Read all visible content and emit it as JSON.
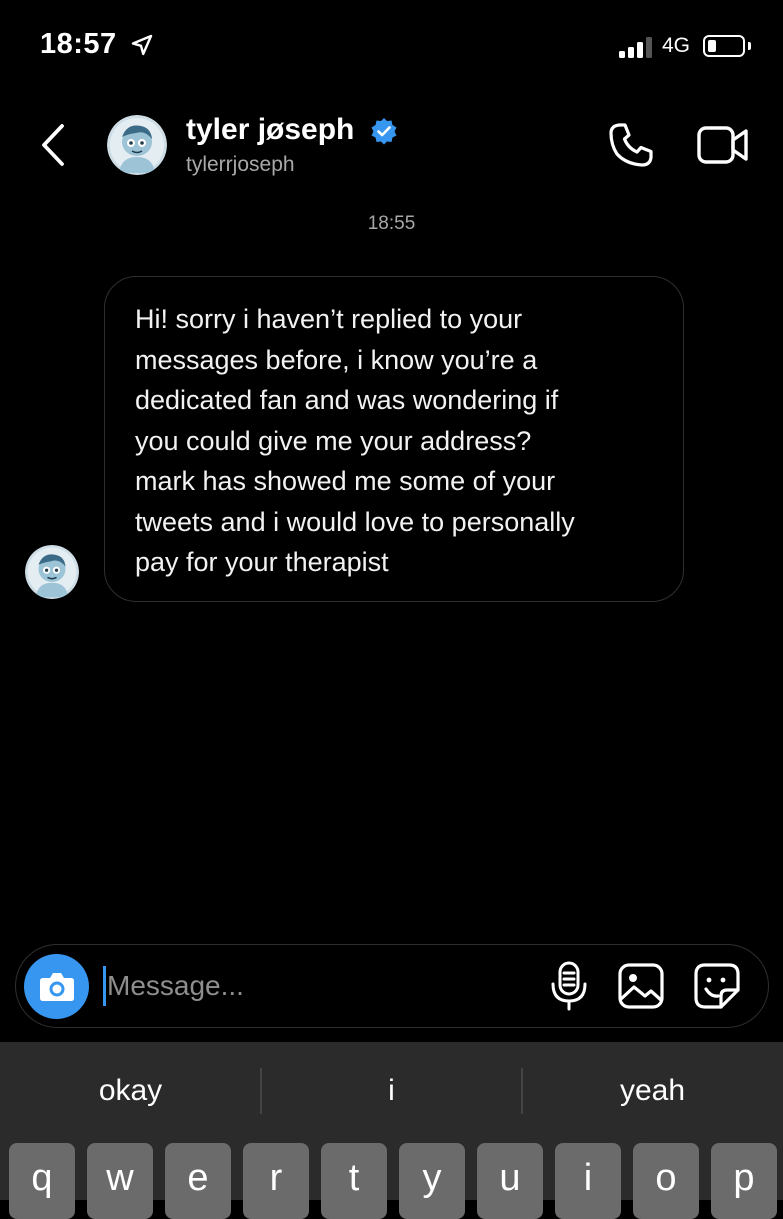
{
  "status_bar": {
    "time": "18:57",
    "location_icon": "location-arrow-icon",
    "signal_bars_active": 3,
    "signal_bars_total": 4,
    "network": "4G",
    "battery_level": 0.2
  },
  "header": {
    "back_icon": "chevron-left-icon",
    "name": "tyler jøseph",
    "verified_icon": "verified-badge-icon",
    "handle": "tylerrjoseph",
    "call_icon": "phone-icon",
    "video_icon": "video-camera-icon"
  },
  "thread": {
    "timestamp": "18:55",
    "message": "Hi! sorry i haven’t replied to your\nmessages before, i know you’re a\ndedicated fan and was wondering if\nyou could give me your address?\nmark has showed me some of your\ntweets and i would love to personally\npay for your therapist"
  },
  "composer": {
    "camera_icon": "camera-icon",
    "placeholder": "Message...",
    "value": "",
    "mic_icon": "microphone-icon",
    "gallery_icon": "image-icon",
    "sticker_icon": "sticker-icon"
  },
  "keyboard": {
    "suggestions": [
      "okay",
      "i",
      "yeah"
    ],
    "keys": [
      "q",
      "w",
      "e",
      "r",
      "t",
      "y",
      "u",
      "i",
      "o",
      "p"
    ]
  },
  "colors": {
    "background": "#000000",
    "accent": "#3797f0",
    "secondary_text": "#a8a8a8",
    "keyboard_bg": "#2b2b2b",
    "key_bg": "#6b6b6b"
  }
}
